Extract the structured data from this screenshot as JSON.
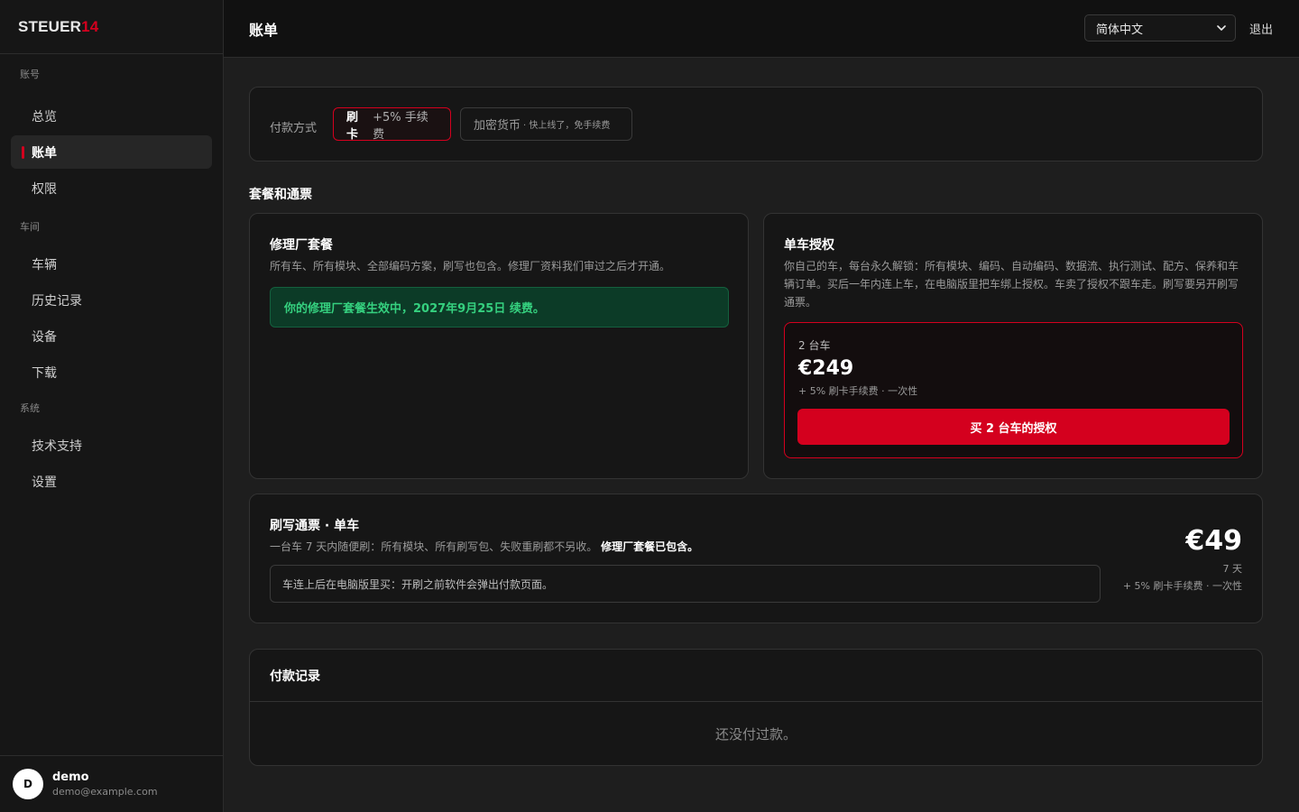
{
  "brand": {
    "name": "STEUER",
    "suffix": "14"
  },
  "sidebar": {
    "groups": [
      {
        "label": "账号",
        "items": [
          {
            "label": "总览"
          },
          {
            "label": "账单",
            "active": true
          },
          {
            "label": "权限"
          }
        ]
      },
      {
        "label": "车间",
        "items": [
          {
            "label": "车辆"
          },
          {
            "label": "历史记录"
          },
          {
            "label": "设备"
          },
          {
            "label": "下载"
          }
        ]
      },
      {
        "label": "系统",
        "items": [
          {
            "label": "技术支持"
          },
          {
            "label": "设置"
          }
        ]
      }
    ]
  },
  "user": {
    "initial": "D",
    "name": "demo",
    "email": "demo@example.com"
  },
  "header": {
    "title": "账单",
    "language": "简体中文",
    "logout": "退出"
  },
  "payment": {
    "label": "付款方式",
    "card": {
      "main": "刷卡",
      "sub": "+5% 手续费",
      "selected": true
    },
    "crypto": {
      "main": "加密货币",
      "sub": "· 快上线了，免手续费"
    }
  },
  "plans": {
    "section_title": "套餐和通票",
    "garage": {
      "title": "修理厂套餐",
      "desc": "所有车、所有模块、全部编码方案，刷写也包含。修理厂资料我们审过之后才开通。",
      "status": "你的修理厂套餐生效中，2027年9月25日 续费。"
    },
    "single": {
      "title": "单车授权",
      "desc": "你自己的车，每台永久解锁：所有模块、编码、自动编码、数据流、执行测试、配方、保养和车辆订单。买后一年内连上车，在电脑版里把车绑上授权。车卖了授权不跟车走。刷写要另开刷写通票。",
      "offer": {
        "qty": "2 台车",
        "price": "€249",
        "fee": "+ 5% 刷卡手续费 · 一次性",
        "button": "买 2 台车的授权"
      }
    }
  },
  "flash": {
    "title": "刷写通票 · 单车",
    "desc": "一台车 7 天内随便刷：所有模块、所有刷写包、失败重刷都不另收。",
    "desc_bold": "修理厂套餐已包含。",
    "note": "车连上后在电脑版里买：开刷之前软件会弹出付款页面。",
    "price": "€49",
    "days": "7 天",
    "fee": "+ 5% 刷卡手续费 · 一次性"
  },
  "records": {
    "title": "付款记录",
    "empty": "还没付过款。"
  },
  "colors": {
    "accent": "#d4001e",
    "success_bg": "#0c3b27",
    "success_text": "#35d07f"
  }
}
